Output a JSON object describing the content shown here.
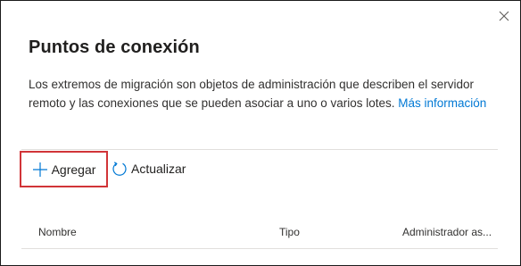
{
  "dialog": {
    "title": "Puntos de conexión",
    "description": "Los extremos de migración son objetos de administración que describen el servidor remoto y las conexiones que se pueden asociar a uno o varios lotes.",
    "link_text": "Más información",
    "close_icon": "close-icon"
  },
  "toolbar": {
    "add_label": "Agregar",
    "add_icon": "plus-icon",
    "refresh_label": "Actualizar",
    "refresh_icon": "refresh-icon"
  },
  "table": {
    "columns": [
      "Nombre",
      "Tipo",
      "Administrador as..."
    ]
  },
  "colors": {
    "accent": "#0078d4",
    "highlight_border": "#d13438"
  }
}
